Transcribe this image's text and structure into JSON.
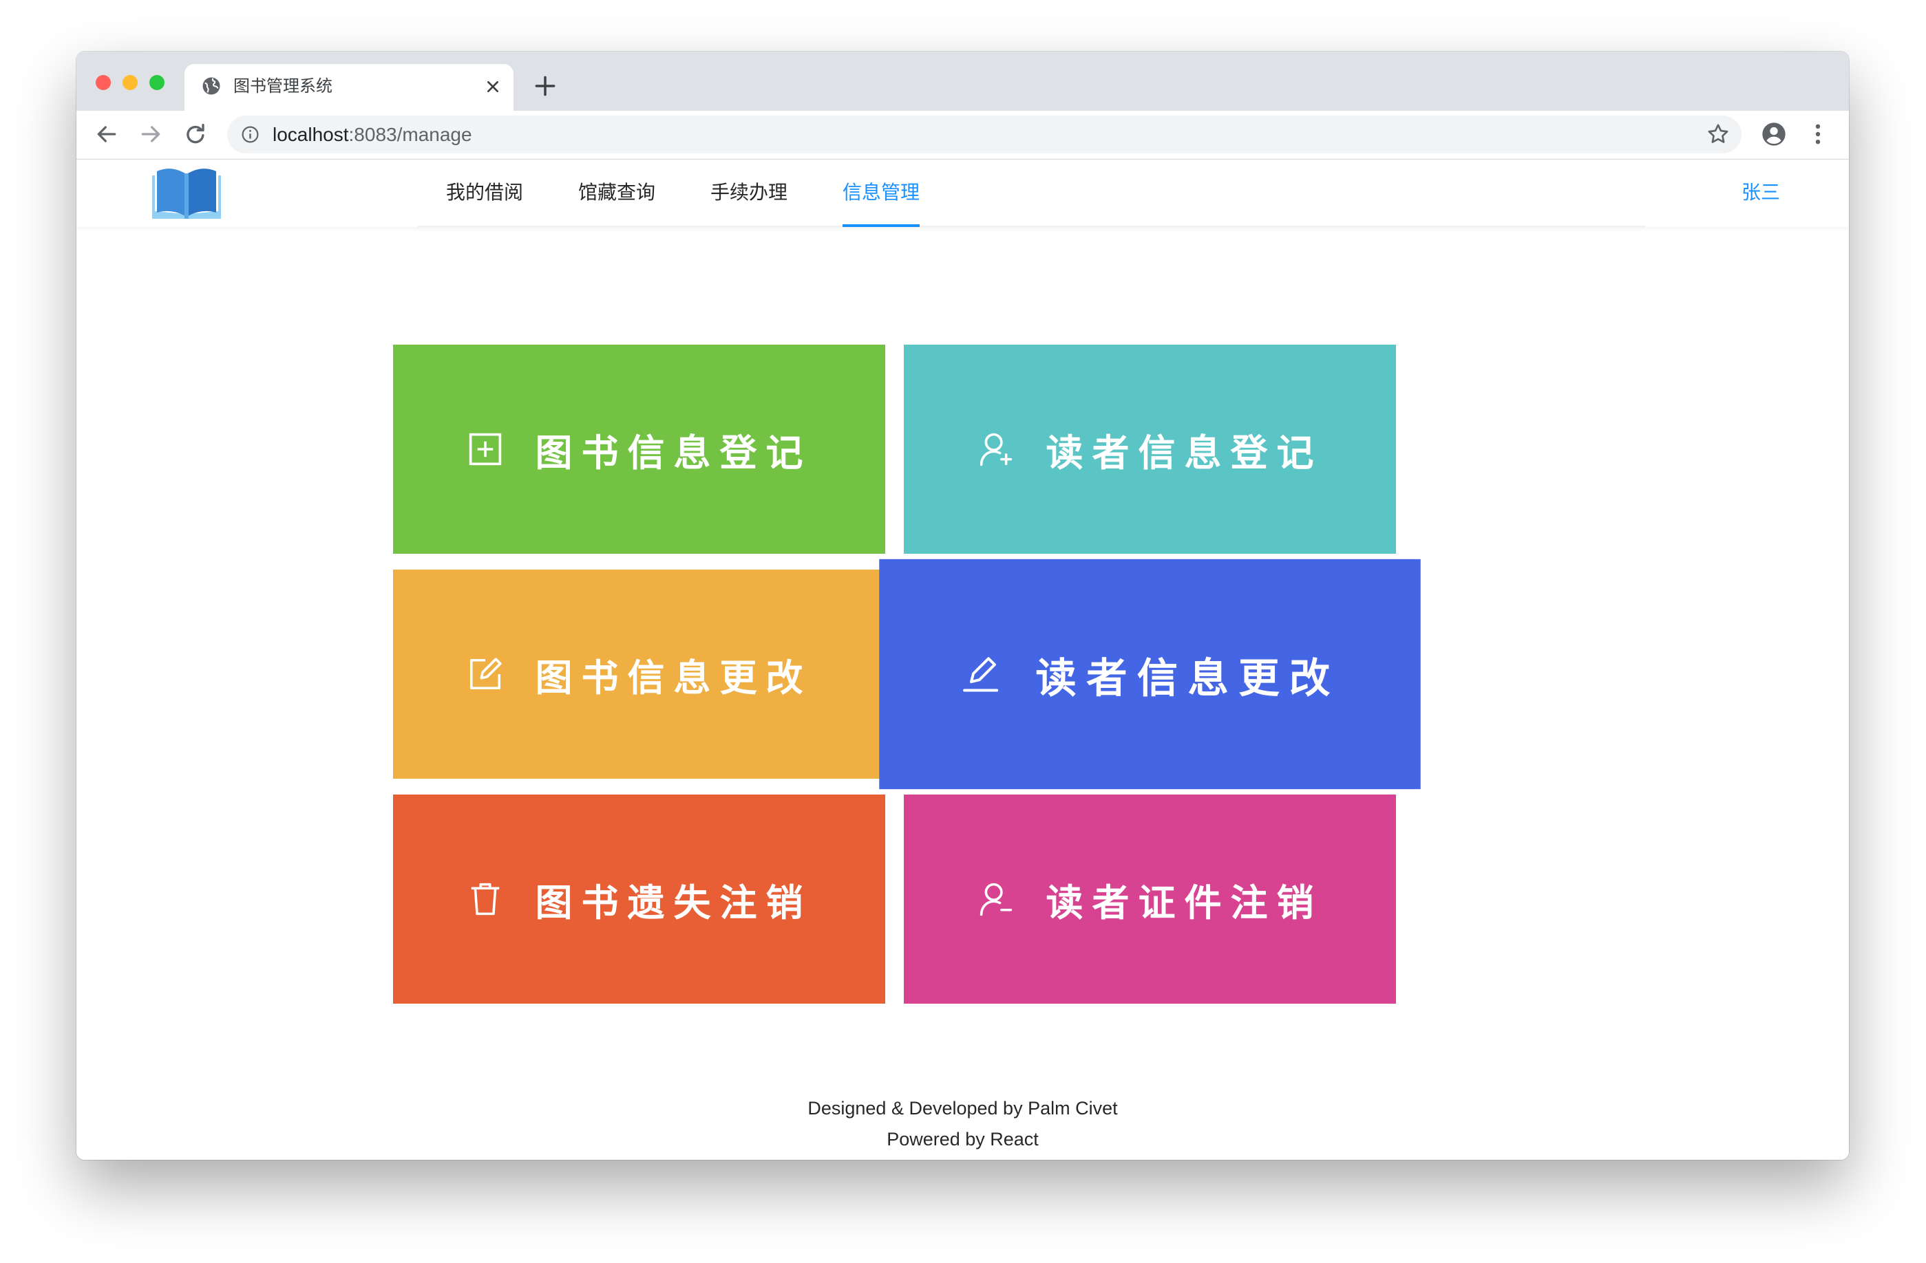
{
  "browser": {
    "tab": {
      "title": "图书管理系统",
      "icon": "globe-icon"
    },
    "address": {
      "host": "localhost",
      "path": ":8083/manage"
    },
    "colors": {
      "tabbar_bg": "#DEE1E6",
      "omnibox_bg": "#F1F3F4"
    }
  },
  "header": {
    "logo": "open-book-icon",
    "nav_items": [
      {
        "label": "我的借阅",
        "active": false
      },
      {
        "label": "馆藏查询",
        "active": false
      },
      {
        "label": "手续办理",
        "active": false
      },
      {
        "label": "信息管理",
        "active": true
      }
    ],
    "user_name": "张三",
    "accent_color": "#1890FF"
  },
  "tiles": [
    {
      "label": "图书信息登记",
      "icon": "plus-square-icon",
      "color": "#74C244",
      "hovered": false
    },
    {
      "label": "读者信息登记",
      "icon": "user-add-icon",
      "color": "#5BC4C4",
      "hovered": false
    },
    {
      "label": "图书信息更改",
      "icon": "form-edit-icon",
      "color": "#EFAF43",
      "hovered": false
    },
    {
      "label": "读者信息更改",
      "icon": "edit-pen-icon",
      "color": "#4466E4",
      "hovered": true
    },
    {
      "label": "图书遗失注销",
      "icon": "delete-icon",
      "color": "#E85F35",
      "hovered": false
    },
    {
      "label": "读者证件注销",
      "icon": "user-delete-icon",
      "color": "#D84391",
      "hovered": false
    }
  ],
  "footer": {
    "line1": "Designed & Developed by Palm Civet",
    "line2": "Powered by React"
  }
}
